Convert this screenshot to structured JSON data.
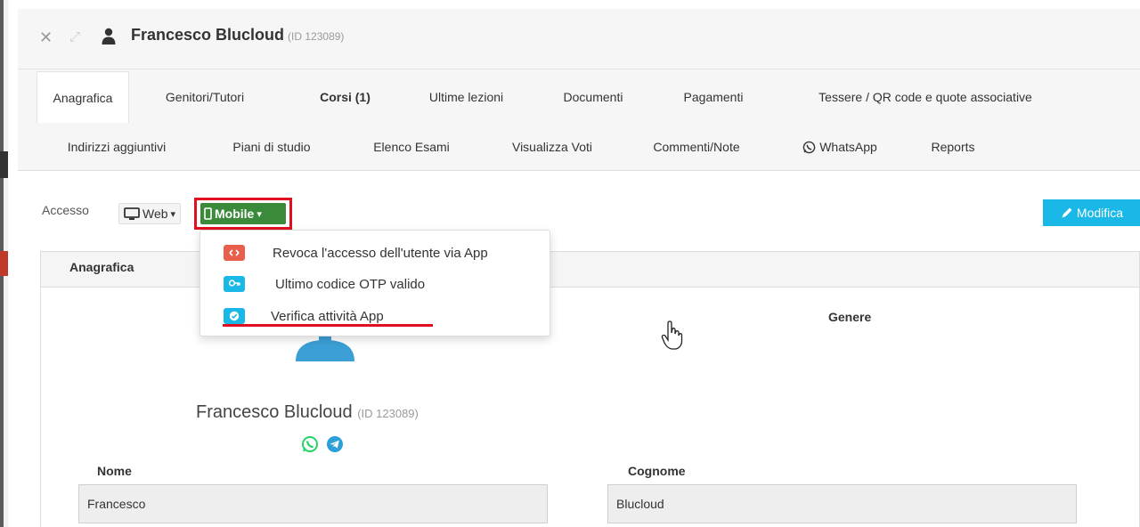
{
  "header": {
    "title": "Francesco Blucloud",
    "title_id": "(ID 123089)",
    "close_glyph": "✕",
    "expand_glyph": "⤢"
  },
  "tabs_row1": [
    "Anagrafica",
    "Genitori/Tutori",
    "Corsi (1)",
    "Ultime lezioni",
    "Documenti",
    "Pagamenti",
    "Tessere / QR code e quote associative"
  ],
  "tabs_row2": [
    "Indirizzi aggiuntivi",
    "Piani di studio",
    "Elenco Esami",
    "Visualizza Voti",
    "Commenti/Note",
    "WhatsApp",
    "Reports"
  ],
  "access": {
    "label": "Accesso",
    "web_label": "Web",
    "mobile_label": "Mobile",
    "caret": "▾"
  },
  "modifica_label": "Modifica",
  "dropdown": {
    "items": [
      {
        "label": "Revoca l'accesso dell'utente via App",
        "icon": "revoke-icon",
        "color": "#e8604c"
      },
      {
        "label": "Ultimo codice OTP valido",
        "icon": "key-icon",
        "color": "#1ab8e6"
      },
      {
        "label": "Verifica attività App",
        "icon": "check-circle-icon",
        "color": "#1ab8e6"
      }
    ]
  },
  "panel": {
    "title": "Anagrafica",
    "genere_label": "Genere",
    "profile_name": "Francesco Blucloud",
    "profile_id": "(ID 123089)",
    "nome_label": "Nome",
    "nome_value": "Francesco",
    "cognome_label": "Cognome",
    "cognome_value": "Blucloud"
  },
  "colors": {
    "accent_blue": "#1ab8e6",
    "mobile_green": "#3a8a3a",
    "highlight_red": "#e0101e",
    "whatsapp_green": "#25d366",
    "telegram_blue": "#2a9fd8"
  }
}
